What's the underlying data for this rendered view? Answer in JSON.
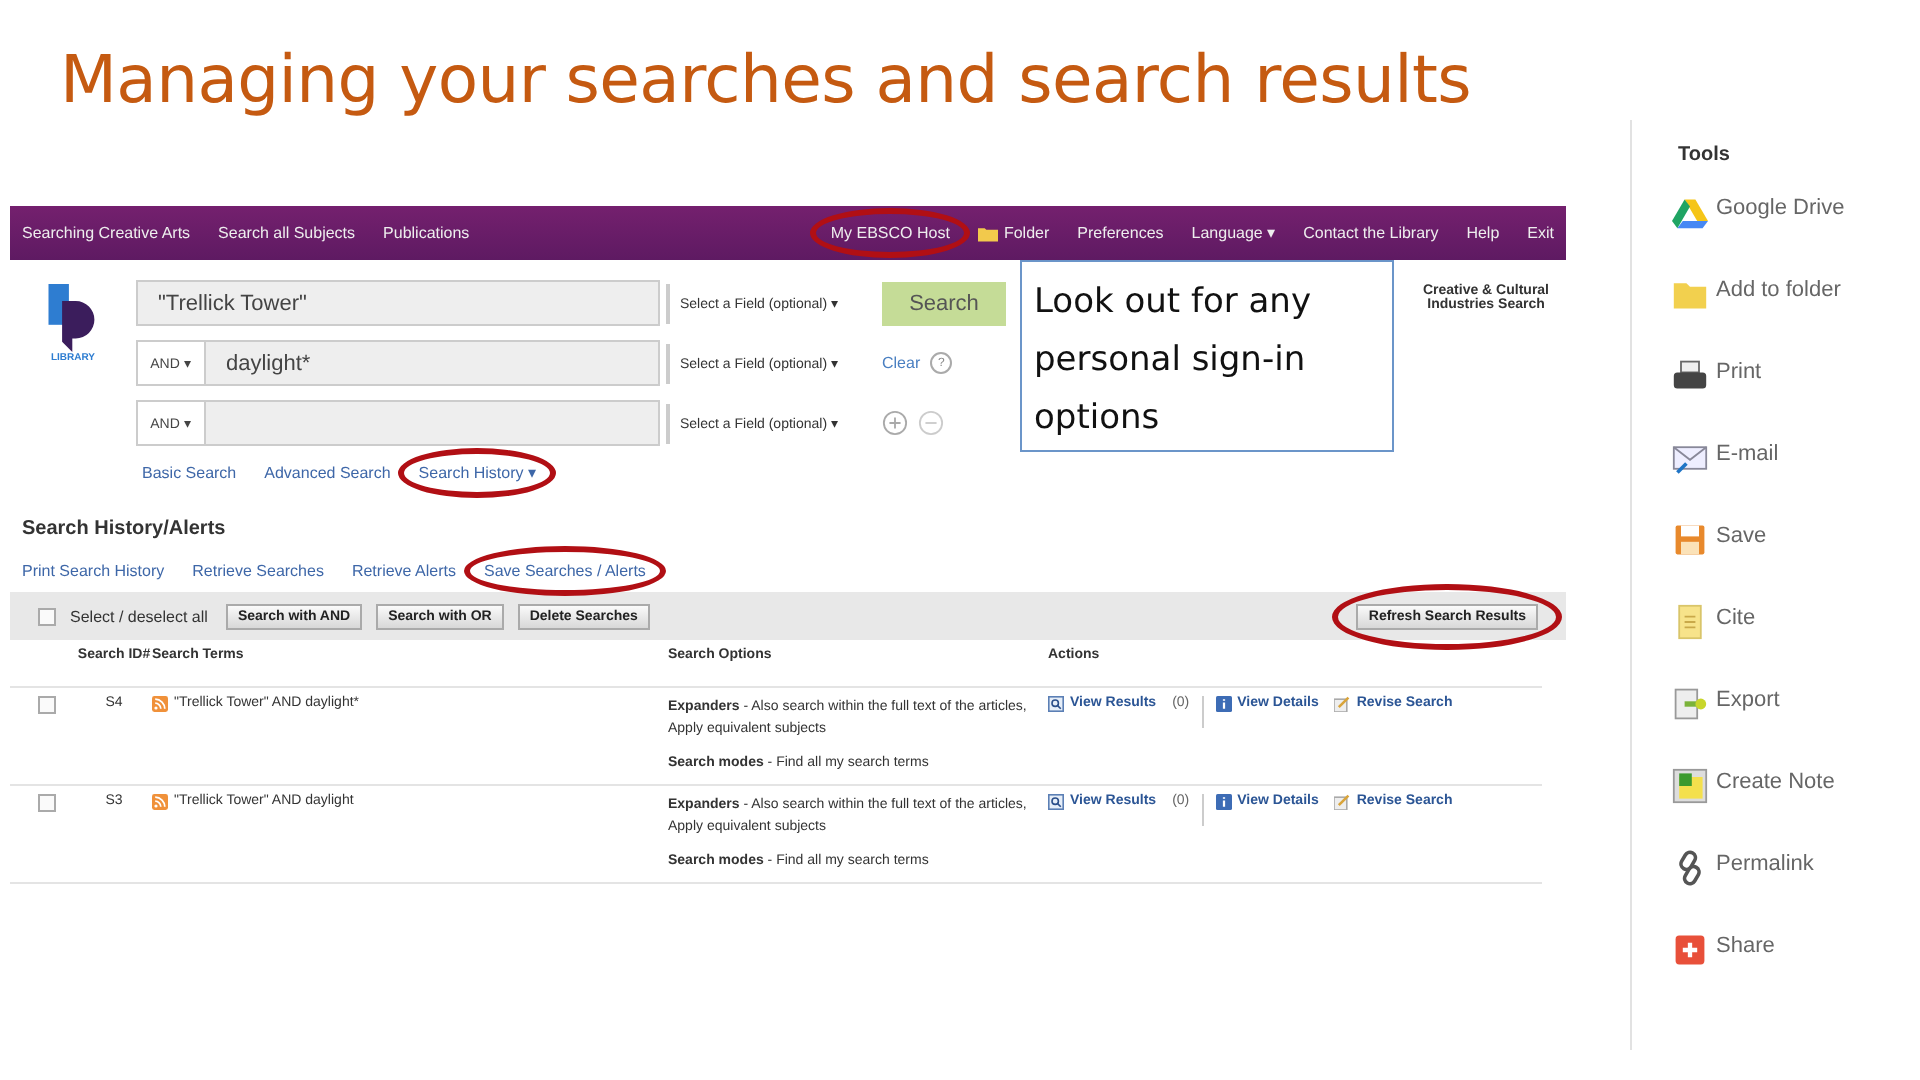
{
  "slide_title": "Managing your searches and search results",
  "callout": "Look out for any personal sign-in options",
  "nav": {
    "left_items": [
      {
        "label": "Searching Creative Arts",
        "highlighted": false
      },
      {
        "label": "Search all Subjects",
        "highlighted": false
      },
      {
        "label": "Publications",
        "highlighted": false
      }
    ],
    "right_items": [
      {
        "label": "My EBSCO Host",
        "highlighted": true
      },
      {
        "label": "Folder",
        "highlighted": false
      },
      {
        "label": "Preferences",
        "highlighted": false
      },
      {
        "label": "Language ▾",
        "highlighted": false
      },
      {
        "label": "Contact the Library",
        "highlighted": false
      },
      {
        "label": "Help",
        "highlighted": false
      },
      {
        "label": "Exit",
        "highlighted": false
      }
    ]
  },
  "search_form": {
    "logo_text": "LIBRARY",
    "rows": [
      {
        "operator": "",
        "value": "\"Trellick Tower\"",
        "field": "Select a Field (optional) ▾"
      },
      {
        "operator": "AND ▾",
        "value": "daylight*",
        "field": "Select a Field (optional) ▾"
      },
      {
        "operator": "AND ▾",
        "value": "",
        "field": "Select a Field (optional) ▾"
      }
    ],
    "search_button": "Search",
    "clear": "Clear",
    "help": "?",
    "database_label": "Creative & Cultural Industries Search",
    "links": [
      {
        "label": "Basic Search",
        "highlighted": false
      },
      {
        "label": "Advanced Search",
        "highlighted": false
      },
      {
        "label": "Search History ▾",
        "highlighted": true
      }
    ]
  },
  "history": {
    "title": "Search History/Alerts",
    "links": [
      {
        "label": "Print Search History",
        "highlighted": false
      },
      {
        "label": "Retrieve Searches",
        "highlighted": false
      },
      {
        "label": "Retrieve Alerts",
        "highlighted": false
      },
      {
        "label": "Save Searches / Alerts",
        "highlighted": true
      }
    ],
    "select_all": {
      "label": "Select / deselect all",
      "checked": false
    },
    "buttons": [
      {
        "label": "Search with AND",
        "highlighted": false
      },
      {
        "label": "Search with OR",
        "highlighted": false
      },
      {
        "label": "Delete Searches",
        "highlighted": false
      }
    ],
    "refresh": {
      "label": "Refresh Search Results",
      "highlighted": true
    },
    "columns": [
      "Search ID#",
      "Search Terms",
      "Search Options",
      "Actions"
    ],
    "rows": [
      {
        "checked": false,
        "id": "S4",
        "terms": "\"Trellick Tower\" AND daylight*",
        "expanders": "**Expanders** - Also search within the full text of the articles, Apply equivalent subjects",
        "modes": "**Search modes** - Find all my search terms",
        "view_results": "View Results",
        "count": "(0)",
        "view_details": "View Details",
        "revise": "Revise Search"
      },
      {
        "checked": false,
        "id": "S3",
        "terms": "\"Trellick Tower\" AND daylight",
        "expanders": "**Expanders** - Also search within the full text of the articles, Apply equivalent subjects",
        "modes": "**Search modes** - Find all my search terms",
        "view_results": "View Results",
        "count": "(0)",
        "view_details": "View Details",
        "revise": "Revise Search"
      }
    ]
  },
  "tools": {
    "title": "Tools",
    "items": [
      "Google Drive",
      "Add to folder",
      "Print",
      "E-mail",
      "Save",
      "Cite",
      "Export",
      "Create Note",
      "Permalink",
      "Share"
    ]
  }
}
